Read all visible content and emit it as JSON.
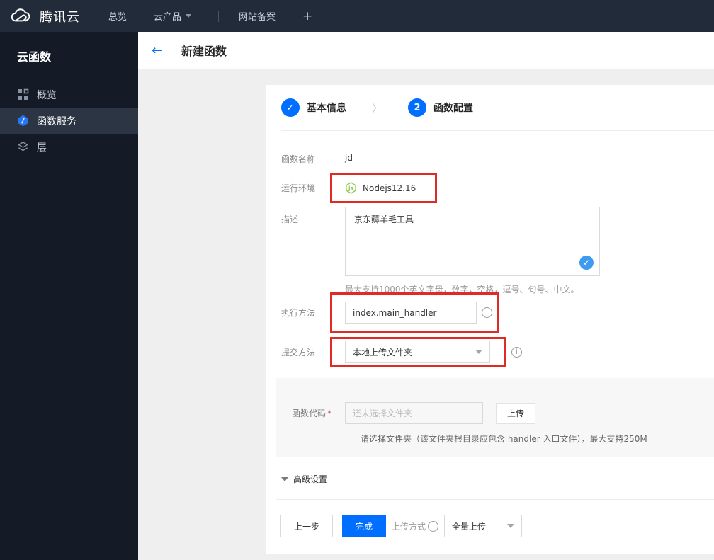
{
  "topnav": {
    "brand": "腾讯云",
    "menu": {
      "overview": "总览",
      "products": "云产品",
      "icp": "网站备案",
      "add": "+"
    }
  },
  "sidebar": {
    "title": "云函数",
    "items": [
      {
        "label": "概览"
      },
      {
        "label": "函数服务"
      },
      {
        "label": "层"
      }
    ]
  },
  "header": {
    "title": "新建函数"
  },
  "steps": {
    "step1": {
      "label": "基本信息"
    },
    "step2": {
      "number": "2",
      "label": "函数配置"
    }
  },
  "form": {
    "name": {
      "label": "函数名称",
      "value": "jd"
    },
    "runtime": {
      "label": "运行环境",
      "value": "Nodejs12.16",
      "icon_text": "js"
    },
    "desc": {
      "label": "描述",
      "value": "京东薅羊毛工具",
      "hint": "最大支持1000个英文字母，数字，空格，逗号、句号、中文。"
    },
    "handler": {
      "label": "执行方法",
      "value": "index.main_handler"
    },
    "submit": {
      "label": "提交方法",
      "value": "本地上传文件夹"
    },
    "code": {
      "label": "函数代码",
      "required_mark": "*",
      "placeholder": "还未选择文件夹",
      "upload": "上传",
      "hint": "请选择文件夹（该文件夹根目录应包含 handler 入口文件），最大支持250M"
    }
  },
  "advanced": {
    "label": "高级设置"
  },
  "footer": {
    "prev": "上一步",
    "done": "完成",
    "upload_mode_label": "上传方式",
    "upload_mode_value": "全量上传"
  },
  "icons": {
    "check": "✓",
    "back_arrow": "←",
    "info": "i",
    "chevron_right": "〉"
  },
  "colors": {
    "primary_blue": "#006eff",
    "annotation_red": "#e02b24",
    "nodejs_green": "#8cc84b",
    "badge_blue": "#3d9bf0",
    "navbar_bg": "#212b3a",
    "sidebar_bg": "#151b26"
  }
}
